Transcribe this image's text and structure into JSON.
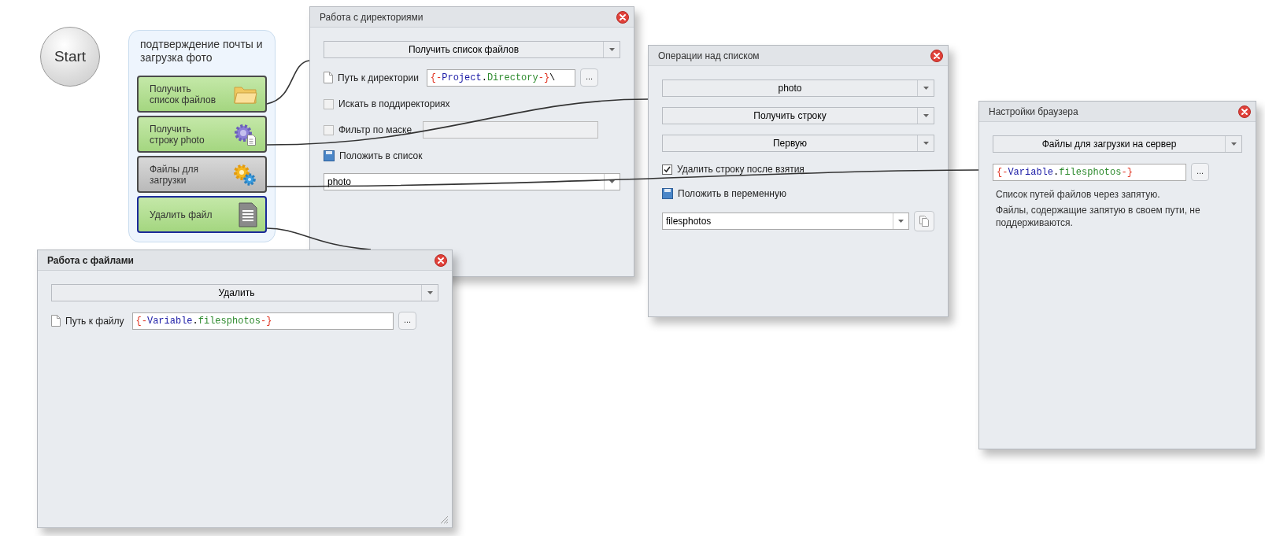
{
  "start": {
    "label": "Start"
  },
  "group": {
    "title": "подтверждение почты и загрузка фото",
    "items": [
      {
        "label": "Получить список файлов",
        "kind": "folder",
        "disabled": false,
        "selected": false
      },
      {
        "label": "Получить строку photo",
        "kind": "gear_doc",
        "disabled": false,
        "selected": false
      },
      {
        "label": "Файлы для загрузки",
        "kind": "gears",
        "disabled": true,
        "selected": false
      },
      {
        "label": "Удалить файл",
        "kind": "document",
        "disabled": false,
        "selected": true
      }
    ]
  },
  "windows": [
    {
      "title": "Работа с директориями",
      "active": false,
      "fields": [
        {
          "kind": "select",
          "value": "Получить список файлов"
        },
        {
          "kind": "path",
          "label": "Путь к директории",
          "button": "...",
          "tokens": [
            {
              "text": "{-",
              "kind": "delimiter"
            },
            {
              "text": "Project",
              "kind": "object"
            },
            {
              "text": ".",
              "kind": "plain"
            },
            {
              "text": "Directory",
              "kind": "member"
            },
            {
              "text": "-}",
              "kind": "delimiter"
            },
            {
              "text": "\\",
              "kind": "plain"
            }
          ]
        },
        {
          "kind": "checkbox",
          "label": "Искать в поддиректориях",
          "checked": false
        },
        {
          "kind": "checkbox_input",
          "label": "Фильтр по маске",
          "checked": false
        },
        {
          "kind": "save_label",
          "label": "Положить в список"
        },
        {
          "kind": "combo",
          "value": "photo"
        }
      ]
    },
    {
      "title": "Операции над списком",
      "active": false,
      "fields": [
        {
          "kind": "select",
          "value": "photo"
        },
        {
          "kind": "select",
          "value": "Получить строку"
        },
        {
          "kind": "select",
          "value": "Первую"
        },
        {
          "kind": "checkbox",
          "label": "Удалить строку после взятия",
          "checked": true
        },
        {
          "kind": "save_label",
          "label": "Положить в переменную"
        },
        {
          "kind": "combo_copy",
          "value": "filesphotos"
        }
      ]
    },
    {
      "title": "Настройки браузера",
      "active": false,
      "fields": [
        {
          "kind": "select",
          "value": "Файлы для загрузки на сервер"
        },
        {
          "kind": "code_field",
          "button": "...",
          "tokens": [
            {
              "text": "{-",
              "kind": "delimiter"
            },
            {
              "text": "Variable",
              "kind": "object"
            },
            {
              "text": ".",
              "kind": "plain"
            },
            {
              "text": "filesphotos",
              "kind": "member"
            },
            {
              "text": "-}",
              "kind": "delimiter"
            }
          ]
        },
        {
          "kind": "note",
          "lines": [
            "Список путей файлов через запятую.",
            "Файлы, содержащие запятую в своем пути, не поддерживаются."
          ]
        }
      ]
    },
    {
      "title": "Работа с файлами",
      "active": true,
      "fields": [
        {
          "kind": "select",
          "value": "Удалить"
        },
        {
          "kind": "path",
          "label": "Путь к файлу",
          "button": "...",
          "tokens": [
            {
              "text": "{-",
              "kind": "delimiter"
            },
            {
              "text": "Variable",
              "kind": "object"
            },
            {
              "text": ".",
              "kind": "plain"
            },
            {
              "text": "filesphotos",
              "kind": "member"
            },
            {
              "text": "-}",
              "kind": "delimiter"
            }
          ]
        }
      ]
    }
  ]
}
